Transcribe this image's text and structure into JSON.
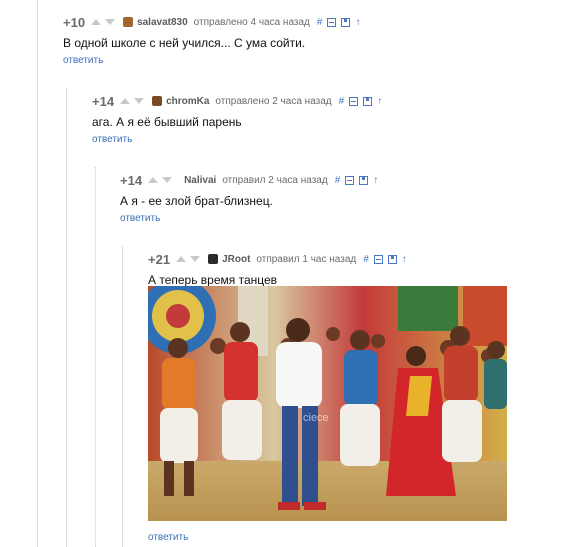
{
  "comments": [
    {
      "rating": "+10",
      "user": "salavat830",
      "time": "отправлено 4 часа назад",
      "text": "В одной школе с ней учился... С ума сойти.",
      "reply": "ответить"
    },
    {
      "rating": "+14",
      "user": "chromKa",
      "time": "отправлено 2 часа назад",
      "text": "ага. А я её бывший парень",
      "reply": "ответить"
    },
    {
      "rating": "+14",
      "user": "Nalivai",
      "time": "отправил 2 часа назад",
      "text": "А я - ее злой брат-близнец.",
      "reply": "ответить"
    },
    {
      "rating": "+21",
      "user": "JRoot",
      "time": "отправил 1 час назад",
      "text": "А теперь время танцев",
      "reply": "ответить"
    }
  ],
  "actions": {
    "hash": "#",
    "up": "↑"
  },
  "photo": {
    "watermark": "ciece"
  },
  "colors": {
    "link": "#3b6fb6",
    "rating": "#6b6b6b",
    "arrow": "#c8c8c8"
  }
}
